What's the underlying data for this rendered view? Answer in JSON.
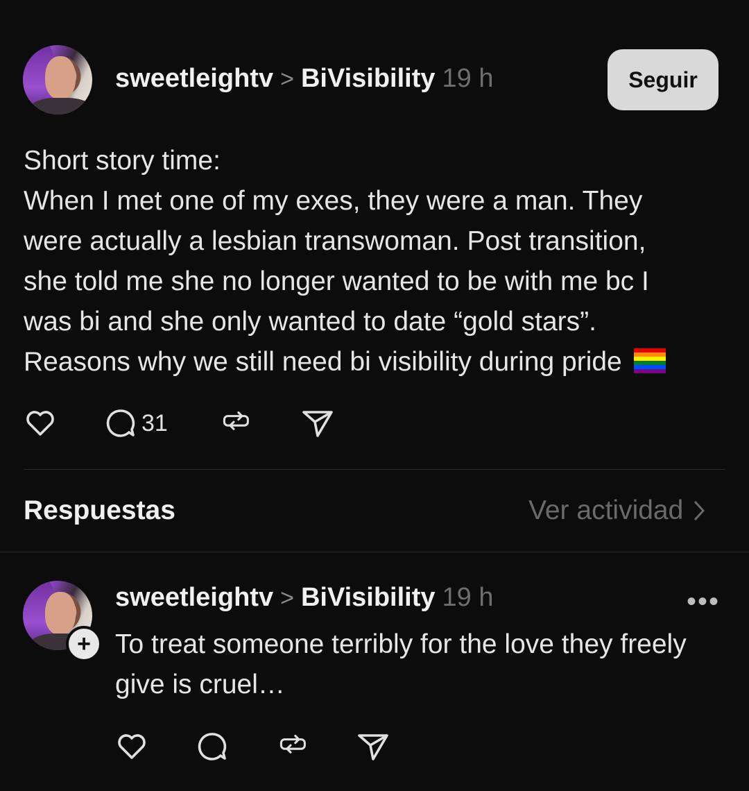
{
  "post": {
    "username": "sweetleightv",
    "separator": ">",
    "community": "BiVisibility",
    "time": "19 h",
    "follow_label": "Seguir",
    "lines": [
      "Short story time:",
      "When I met one of my exes, they were a man. They",
      "were actually a lesbian transwoman. Post transition,",
      "she told me she no longer wanted to be with me bc I",
      "was bi and she only wanted to date “gold stars”.",
      "Reasons why we still need bi visibility during pride"
    ],
    "comment_count": "31"
  },
  "replies_section": {
    "title": "Respuestas",
    "activity_label": "Ver actividad"
  },
  "reply": {
    "username": "sweetleightv",
    "separator": ">",
    "community": "BiVisibility",
    "time": "19 h",
    "more": "•••",
    "plus": "+",
    "lines": [
      "To treat someone terribly for the love they freely",
      "give is cruel…"
    ]
  },
  "icons": [
    "heart-icon",
    "comment-icon",
    "repost-icon",
    "share-icon",
    "rainbow-flag-icon",
    "chevron-right-icon",
    "more-icon",
    "follow-plus-icon"
  ],
  "colors": {
    "background": "#0c0c0c",
    "text": "#e6e6e6",
    "muted": "#6e6e6e",
    "follow_button": "#d9d9d9"
  }
}
